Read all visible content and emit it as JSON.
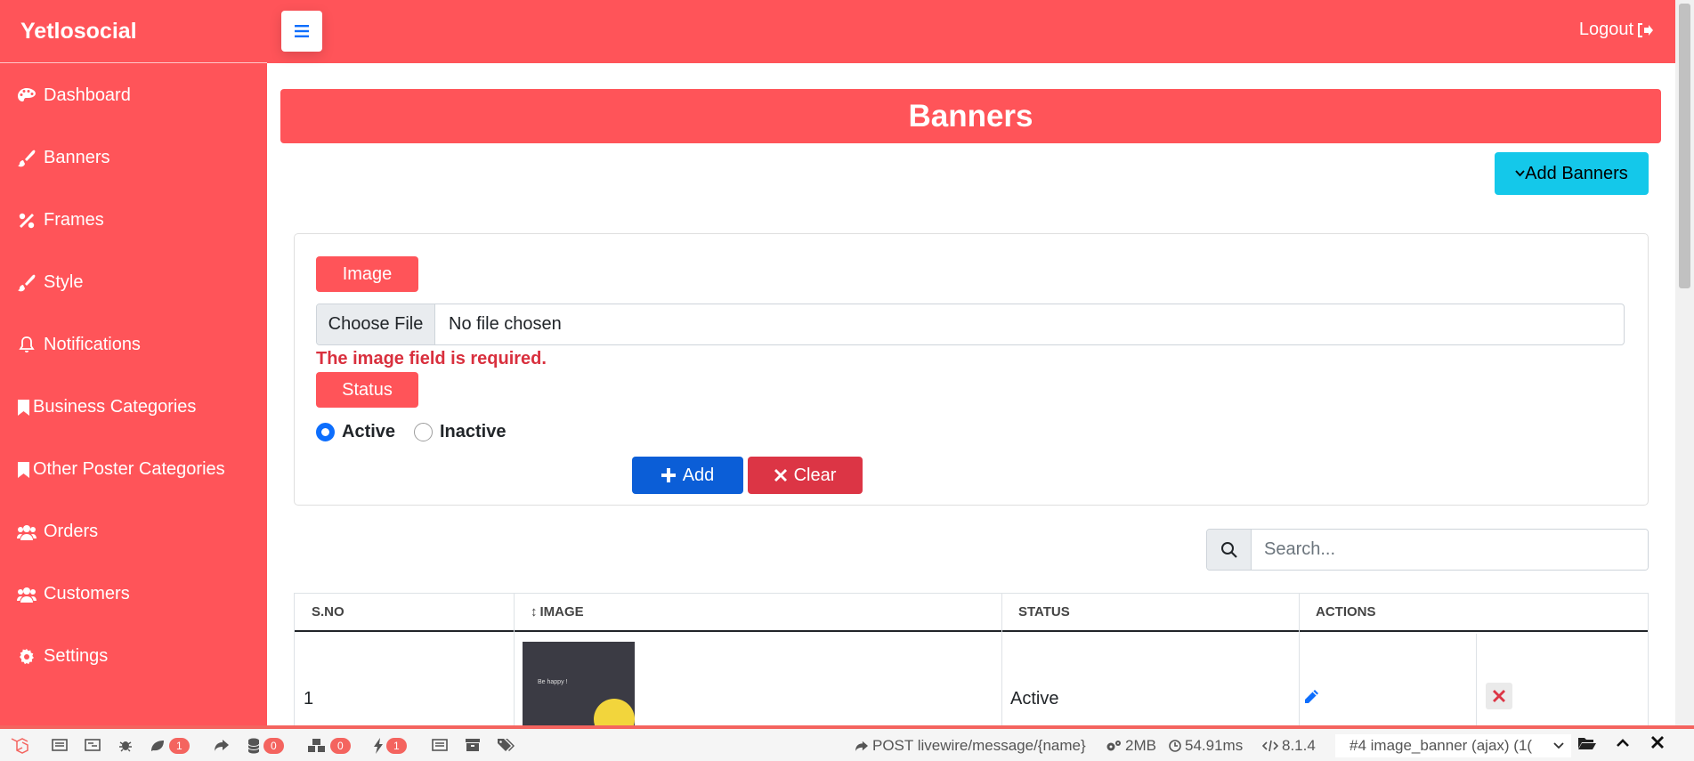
{
  "app": {
    "brand": "Yetlosocial",
    "logout_label": "Logout"
  },
  "sidebar": {
    "items": [
      {
        "label": "Dashboard",
        "icon": "palette-icon"
      },
      {
        "label": "Banners",
        "icon": "brush-icon"
      },
      {
        "label": "Frames",
        "icon": "percent-icon"
      },
      {
        "label": "Style",
        "icon": "brush-icon"
      },
      {
        "label": "Notifications",
        "icon": "bell-icon"
      },
      {
        "label": "Business Categories",
        "icon": "bookmark-icon"
      },
      {
        "label": "Other Poster Categories",
        "icon": "bookmark-icon"
      },
      {
        "label": "Orders",
        "icon": "users-icon"
      },
      {
        "label": "Customers",
        "icon": "users-icon"
      },
      {
        "label": "Settings",
        "icon": "gear-icon"
      }
    ]
  },
  "page": {
    "title": "Banners",
    "add_button": "Add Banners"
  },
  "form": {
    "image_label": "Image",
    "file_button": "Choose File",
    "file_status": "No file chosen",
    "error": "The image field is required.",
    "status_label": "Status",
    "radio_active": "Active",
    "radio_inactive": "Inactive",
    "selected_status": "Active",
    "add_button": "Add",
    "clear_button": "Clear"
  },
  "search": {
    "placeholder": "Search..."
  },
  "table": {
    "headers": [
      "S.NO",
      "IMAGE",
      "STATUS",
      "ACTIONS"
    ],
    "rows": [
      {
        "sno": "1",
        "image_caption": "Be happy !",
        "status": "Active"
      }
    ]
  },
  "debugbar": {
    "badges": [
      "1",
      "0",
      "0",
      "1"
    ],
    "request": "POST livewire/message/{name}",
    "memory": "2MB",
    "time": "54.91ms",
    "php": "8.1.4",
    "selected_request": "#4 image_banner (ajax) (1("
  },
  "colors": {
    "brand": "#ff5459",
    "info": "#14c8ea",
    "primary": "#0b5ed7",
    "danger": "#dc3545"
  }
}
